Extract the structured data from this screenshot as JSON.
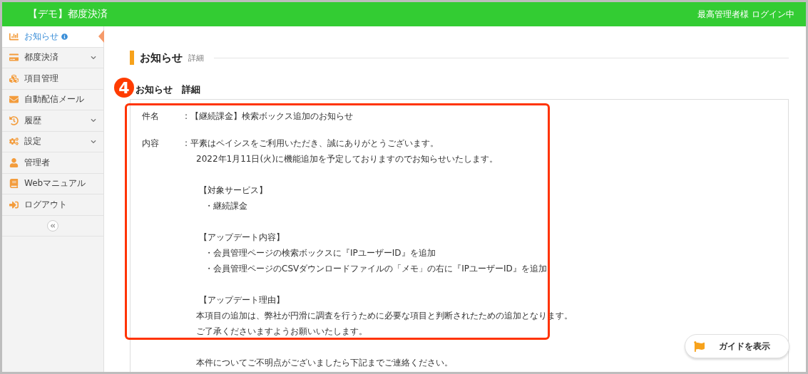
{
  "header": {
    "title": "【デモ】都度決済",
    "user": "最高管理者様 ログイン中"
  },
  "sidebar": {
    "items": [
      {
        "label": "お知らせ",
        "selected": true,
        "expandable": false,
        "info": true
      },
      {
        "label": "都度決済",
        "selected": false,
        "expandable": true,
        "info": false
      },
      {
        "label": "項目管理",
        "selected": false,
        "expandable": false,
        "info": false
      },
      {
        "label": "自動配信メール",
        "selected": false,
        "expandable": false,
        "info": false
      },
      {
        "label": "履歴",
        "selected": false,
        "expandable": true,
        "info": false
      },
      {
        "label": "設定",
        "selected": false,
        "expandable": true,
        "info": false
      },
      {
        "label": "管理者",
        "selected": false,
        "expandable": false,
        "info": false
      },
      {
        "label": "Webマニュアル",
        "selected": false,
        "expandable": false,
        "info": false
      },
      {
        "label": "ログアウト",
        "selected": false,
        "expandable": false,
        "info": false
      }
    ]
  },
  "page_title": {
    "main": "お知らせ",
    "sub": "詳細"
  },
  "detail": {
    "badge": "4",
    "heading": "お知らせ　詳細",
    "fields": [
      {
        "label": "件名",
        "separator": ":",
        "lines": [
          {
            "kind": "first",
            "text": "【継続課金】検索ボックス追加のお知らせ",
            "gap": false
          }
        ]
      },
      {
        "label": "内容",
        "separator": ":",
        "lines": [
          {
            "kind": "first",
            "text": "平素はペイシスをご利用いただき、誠にありがとうございます。",
            "gap": false
          },
          {
            "kind": "text",
            "text": "2022年1月11日(火)に機能追加を予定しておりますのでお知らせいたします。",
            "gap": false
          },
          {
            "kind": "heading",
            "text": "【対象サービス】",
            "gap": true
          },
          {
            "kind": "bullet",
            "text": "・継続課金",
            "gap": false
          },
          {
            "kind": "heading",
            "text": "【アップデート内容】",
            "gap": true
          },
          {
            "kind": "bullet",
            "text": "・会員管理ページの検索ボックスに『IPユーザーID』を追加",
            "gap": false
          },
          {
            "kind": "bullet",
            "text": "・会員管理ページのCSVダウンロードファイルの「メモ」の右に『IPユーザーID』を追加",
            "gap": false
          },
          {
            "kind": "heading",
            "text": "【アップデート理由】",
            "gap": true
          },
          {
            "kind": "text",
            "text": "本項目の追加は、弊社が円滑に調査を行うために必要な項目と判断されたための追加となります。",
            "gap": false
          },
          {
            "kind": "text",
            "text": "ご了承くださいますようお願いいたします。",
            "gap": false
          },
          {
            "kind": "text",
            "text": "本件についてご不明点がございましたら下記までご連絡ください。",
            "gap": true
          }
        ]
      }
    ]
  },
  "guide_button": {
    "label": "ガイドを表示"
  }
}
